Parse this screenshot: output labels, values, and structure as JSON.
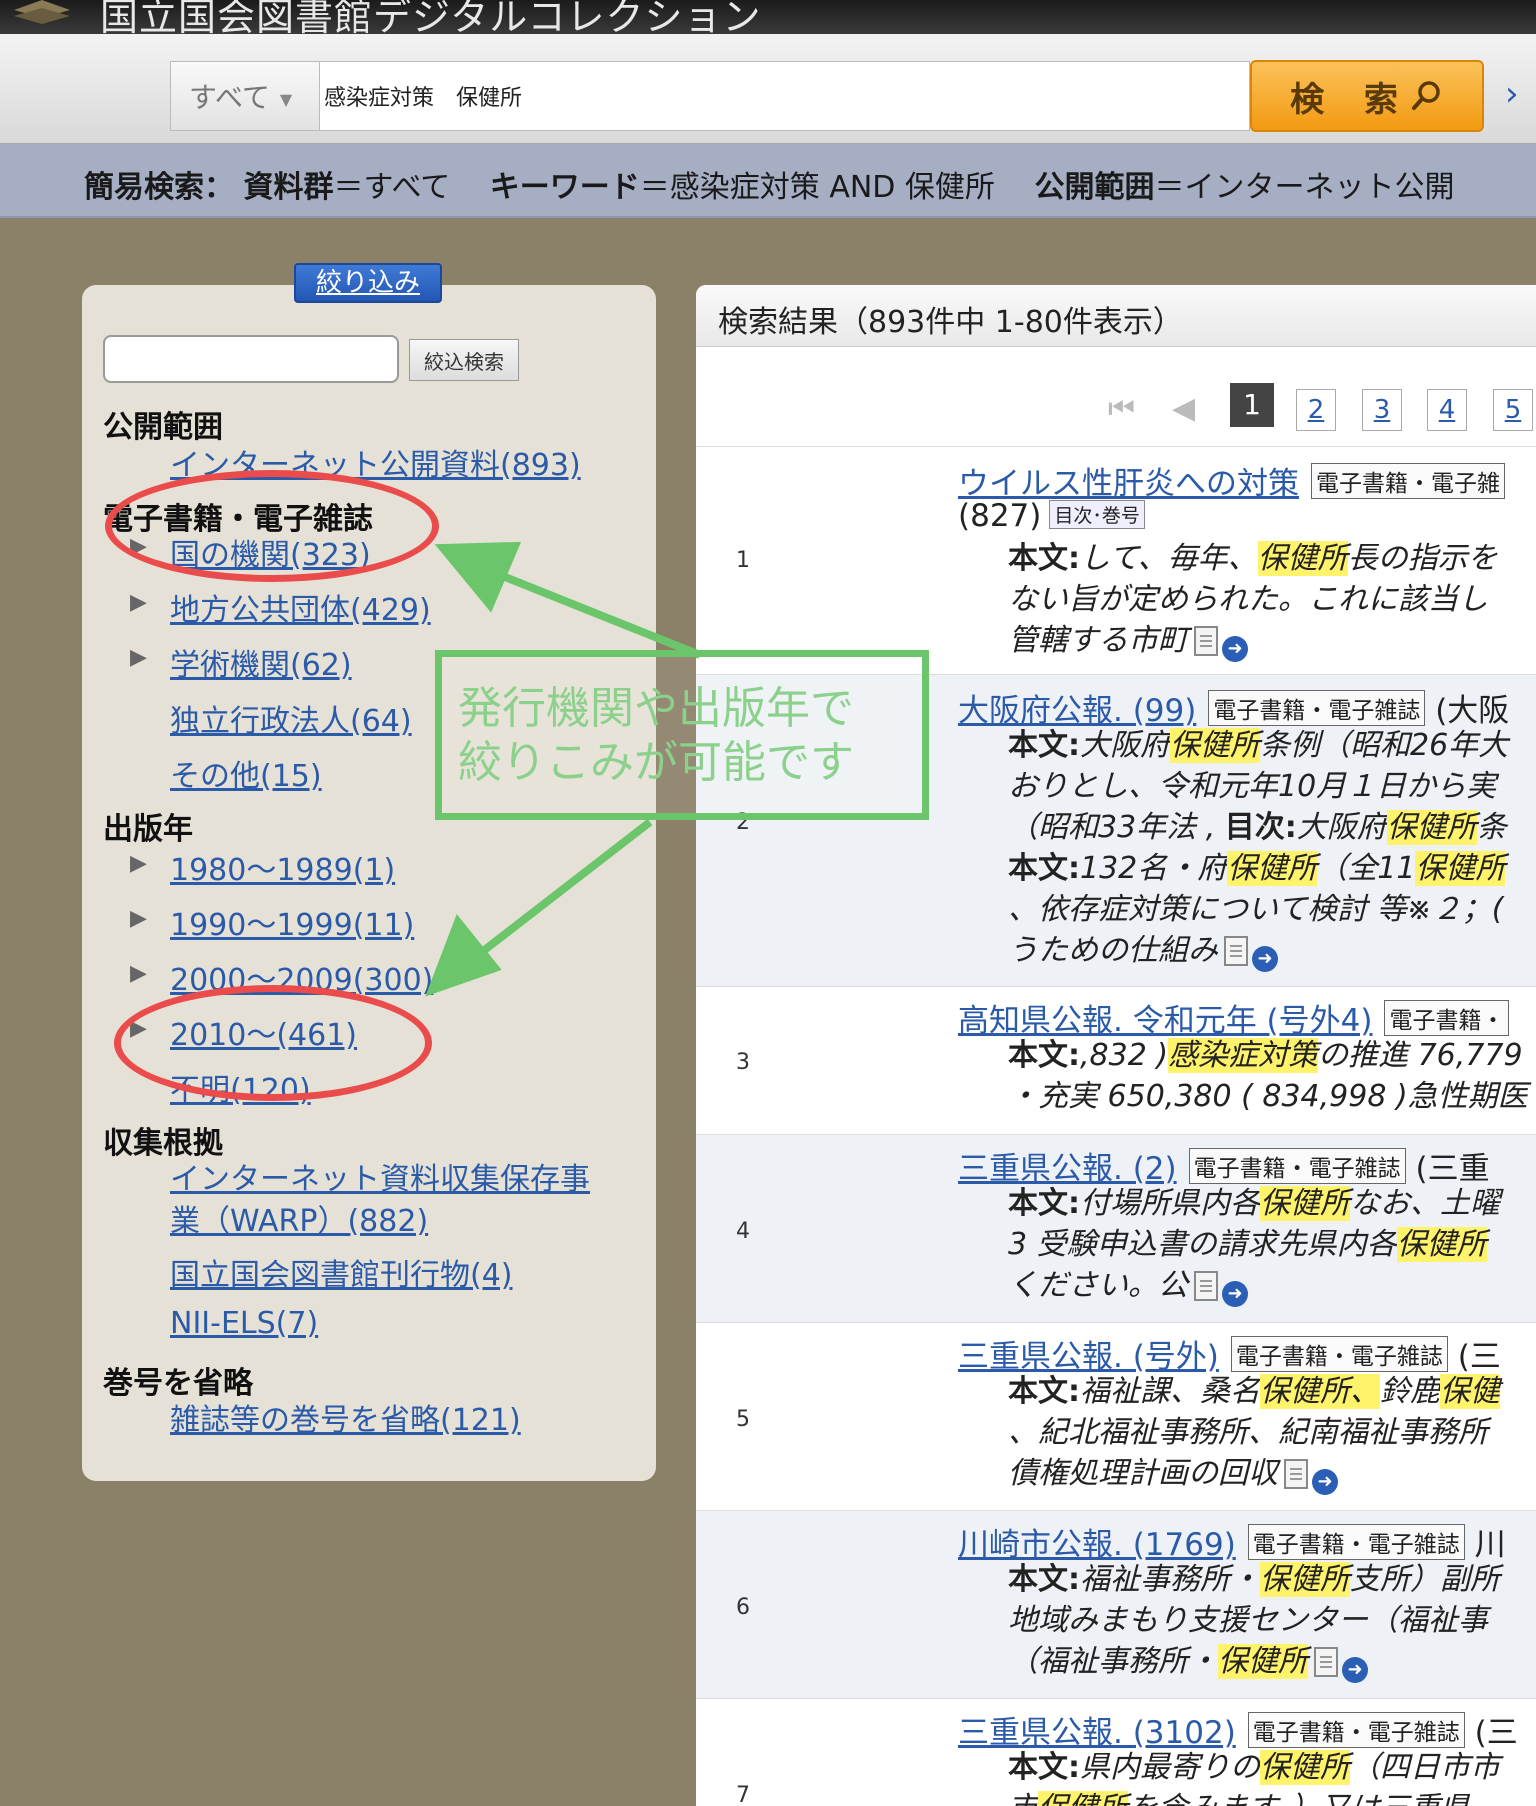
{
  "site": {
    "title": "国立国会図書館デジタルコレクション",
    "accent": "#2a5aa8"
  },
  "search": {
    "scope_label": "すべて",
    "query": "感染症対策　保健所",
    "button_label": "検 索",
    "more_icon": "chevron-right-icon"
  },
  "conditions": {
    "prefix": "簡易検索：",
    "group_key": "資料群",
    "group_val": "＝すべて　",
    "keyword_key": "キーワード",
    "keyword_val": "＝感染症対策 AND 保健所　",
    "range_key": "公開範囲",
    "range_val": "＝インターネット公開"
  },
  "facets": {
    "title": "絞り込み",
    "search_button": "絞込検索",
    "sections": {
      "range": {
        "heading": "公開範囲",
        "items": [
          "インターネット公開資料(893)"
        ]
      },
      "ebooks": {
        "heading": "電子書籍・電子雑誌",
        "items": [
          "国の機関(323)",
          "地方公共団体(429)",
          "学術機関(62)",
          "独立行政法人(64)",
          "その他(15)"
        ]
      },
      "year": {
        "heading": "出版年",
        "items": [
          "1980～1989(1)",
          "1990～1999(11)",
          "2000～2009(300)",
          "2010～(461)",
          "不明(120)"
        ]
      },
      "basis": {
        "heading": "収集根拠",
        "items": [
          "インターネット資料収集保存事",
          "業（WARP）(882)",
          "国立国会図書館刊行物(4)",
          "NII-ELS(7)"
        ]
      },
      "vol": {
        "heading": "巻号を省略",
        "items": [
          "雑誌等の巻号を省略(121)"
        ]
      }
    }
  },
  "annotation": {
    "line1": "発行機関や出版年で",
    "line2": "絞りこみが可能です",
    "arrow_color": "#6bc56b",
    "circle_color": "#ea4c4c"
  },
  "results": {
    "header": "検索結果（893件中 1-80件表示）",
    "pages": [
      "1",
      "2",
      "3",
      "4",
      "5"
    ],
    "tag": "電子書籍・電子雑誌",
    "body_label": "本文:",
    "toc_label": "目次:",
    "highlight_color": "#fff36b",
    "items": [
      {
        "num": "1",
        "title": "ウイルス性肝炎への対策",
        "tag": "電子書籍・電子雑",
        "extra": "(827)",
        "toc": "目次･巻号",
        "s1a": "して、毎年、",
        "s1h": "保健所",
        "s1b": "長の指示を",
        "s2": "ない旨が定められた。これに該当し",
        "s3": "管轄する市町"
      },
      {
        "num": "2",
        "title": "大阪府公報. (99)",
        "after": "(大阪",
        "s1a": "大阪府",
        "s1h": "保健所",
        "s1b": "条例（昭和26年大",
        "s2": "おりとし、令和元年10月１日から実",
        "s3a": "（昭和33年法 , ",
        "s3b": "大阪府",
        "s3h": "保健所",
        "s3c": "条",
        "s4a": "132名・府",
        "s4h": "保健所",
        "s4b": "（全11",
        "s4h2": "保健所",
        "s5": "、依存症対策について検討 等※２；(",
        "s6": "うための仕組み"
      },
      {
        "num": "3",
        "title": "高知県公報. 令和元年 (号外4)",
        "tag": "電子書籍・",
        "s1a": ",832 )",
        "s1h": "感染症対策",
        "s1b": "の推進 76,779",
        "s2": "・充実 650,380 ( 834,998 )急性期医"
      },
      {
        "num": "4",
        "title": "三重県公報. (2)",
        "after": "(三重",
        "s1a": "付場所県内各",
        "s1h": "保健所",
        "s1b": "なお、土曜",
        "s2a": "3 受験申込書の請求先県内各",
        "s2h": "保健所",
        "s3": "ください。公"
      },
      {
        "num": "5",
        "title": "三重県公報. (号外)",
        "after": "(三",
        "s1a": "福祉課、桑名",
        "s1h": "保健所、",
        "s1b": "鈴鹿",
        "s1h2": "保健",
        "s2": "、紀北福祉事務所、紀南福祉事務所",
        "s3": "債権処理計画の回収"
      },
      {
        "num": "6",
        "title": "川崎市公報. (1769)",
        "after": "川",
        "s1a": "福祉事務所・",
        "s1h": "保健所",
        "s1b": "支所）副所",
        "s2": "地域みまもり支援センター（福祉事",
        "s3a": "（福祉事務所・",
        "s3h": "保健所"
      },
      {
        "num": "7",
        "title": "三重県公報. (3102)",
        "after": "(三",
        "s1a": "県内最寄りの",
        "s1h": "保健所",
        "s1b": "（四日市市",
        "s2a": "市",
        "s2h": "保健所",
        "s2b": "を含みます。）又は三重県"
      }
    ]
  }
}
